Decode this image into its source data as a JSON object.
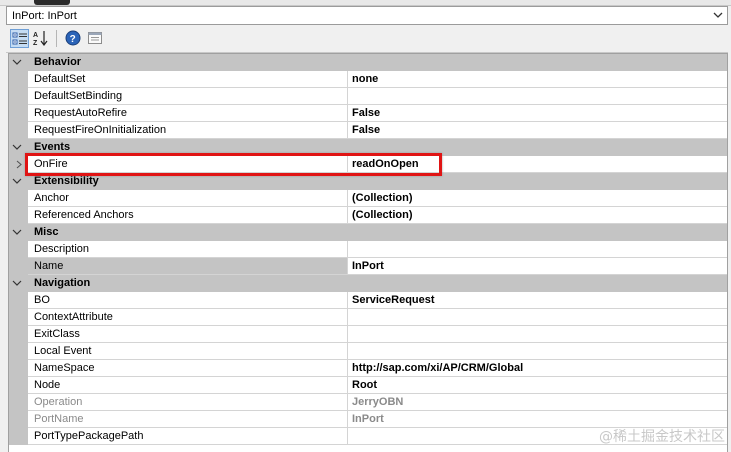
{
  "window": {
    "object_selector": "InPort: InPort"
  },
  "toolbar": {
    "categorized": "categorized-view",
    "alphabetical": "alphabetical-sort",
    "help": "help",
    "property_pages": "property-pages"
  },
  "grid": [
    {
      "category": "Behavior",
      "props": [
        {
          "name": "DefaultSet",
          "value": "none"
        },
        {
          "name": "DefaultSetBinding",
          "value": ""
        },
        {
          "name": "RequestAutoRefire",
          "value": "False"
        },
        {
          "name": "RequestFireOnInitialization",
          "value": "False"
        }
      ]
    },
    {
      "category": "Events",
      "props": [
        {
          "name": "OnFire",
          "value": "readOnOpen",
          "expandable": true,
          "highlighted": true
        }
      ]
    },
    {
      "category": "Extensibility",
      "props": [
        {
          "name": "Anchor",
          "value": "(Collection)"
        },
        {
          "name": "Referenced Anchors",
          "value": "(Collection)"
        }
      ]
    },
    {
      "category": "Misc",
      "props": [
        {
          "name": "Description",
          "value": ""
        },
        {
          "name": "Name",
          "value": "InPort",
          "selected": true
        }
      ]
    },
    {
      "category": "Navigation",
      "props": [
        {
          "name": "BO",
          "value": "ServiceRequest"
        },
        {
          "name": "ContextAttribute",
          "value": ""
        },
        {
          "name": "ExitClass",
          "value": ""
        },
        {
          "name": "Local Event",
          "value": ""
        },
        {
          "name": "NameSpace",
          "value": "http://sap.com/xi/AP/CRM/Global"
        },
        {
          "name": "Node",
          "value": "Root"
        },
        {
          "name": "Operation",
          "value": "JerryOBN",
          "readonly": true
        },
        {
          "name": "PortName",
          "value": "InPort",
          "readonly": true
        },
        {
          "name": "PortTypePackagePath",
          "value": ""
        }
      ]
    }
  ],
  "watermark": "@稀土掘金技术社区",
  "colors": {
    "highlight": "#e01414",
    "category_bg": "#c4c4c4"
  }
}
